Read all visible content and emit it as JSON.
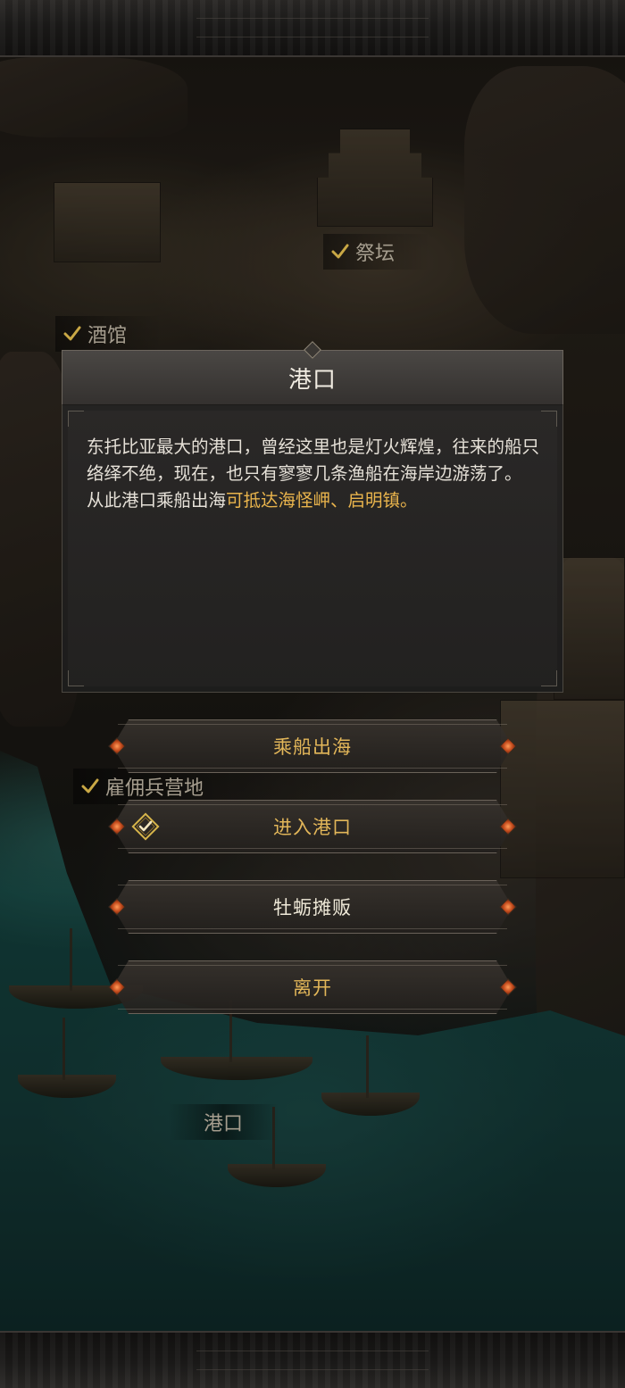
{
  "map": {
    "labels": {
      "altar": "祭坛",
      "tavern": "酒馆",
      "mercenary_camp": "雇佣兵营地",
      "harbor": "港口"
    }
  },
  "dialog": {
    "title": "港口",
    "description": "东托比亚最大的港口，曾经这里也是灯火辉煌，往来的船只络绎不绝，现在，也只有寥寥几条渔船在海岸边游荡了。",
    "travel_prefix": "从此港口乘船出海",
    "travel_destinations": "可抵达海怪岬、启明镇。"
  },
  "options": [
    {
      "label": "乘船出海",
      "visited": false
    },
    {
      "label": "进入港口",
      "visited": true,
      "icon": "visited-check-icon"
    },
    {
      "label": "牡蛎摊贩",
      "visited": false
    },
    {
      "label": "离开",
      "visited": false
    }
  ],
  "colors": {
    "option_text": "#e2b659",
    "highlight_text": "#e9b44c",
    "gem": "#c24a1c",
    "check": "#d7b54a"
  }
}
